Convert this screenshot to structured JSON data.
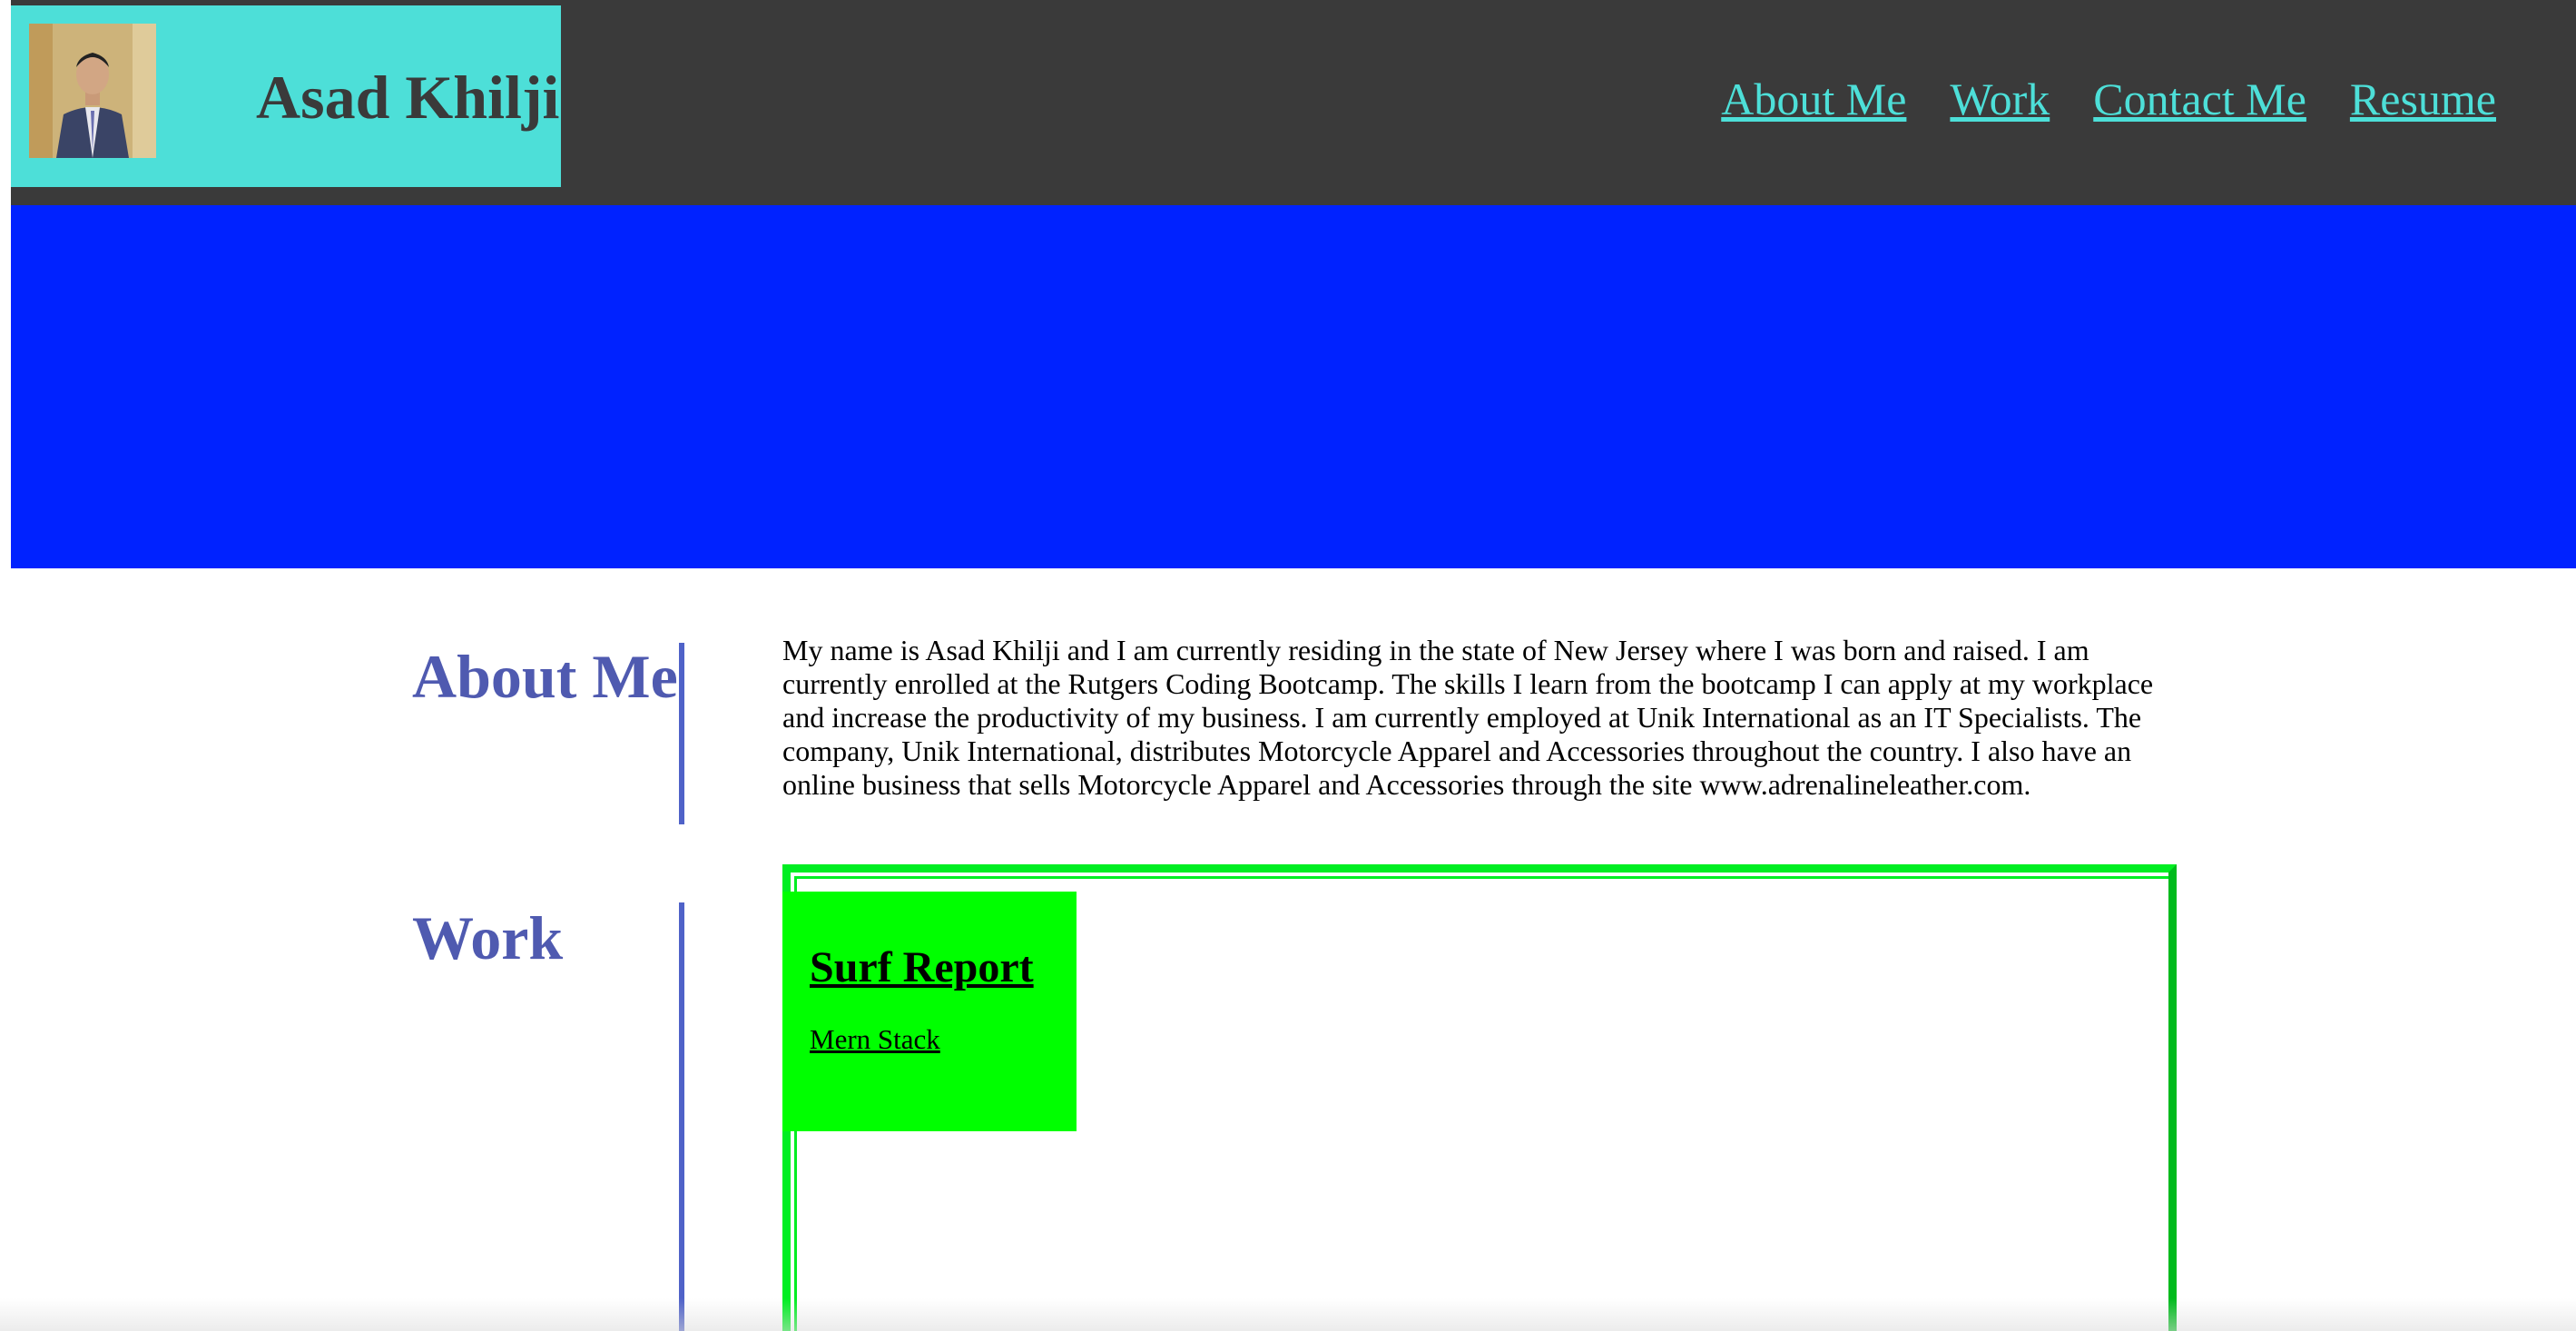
{
  "header": {
    "avatar_alt": "Asad Khilji photo",
    "brand_name": "Asad Khilji",
    "nav": [
      {
        "label": "About Me"
      },
      {
        "label": "Work"
      },
      {
        "label": "Contact Me"
      },
      {
        "label": "Resume"
      }
    ]
  },
  "about": {
    "title": "About Me",
    "text": "My name is Asad Khilji and I am currently residing in the state of New Jersey where I was born and raised. I am currently enrolled at the Rutgers Coding Bootcamp. The skills I learn from the bootcamp I can apply at my workplace and increase the productivity of my business. I am currently employed at Unik International as an IT Specialists. The company, Unik International, distributes Motorcycle Apparel and Accessories throughout the country. I also have an online business that sells Motorcycle Apparel and Accessories through the site www.adrenalineleather.com."
  },
  "work": {
    "title": "Work",
    "projects": [
      {
        "title": "Surf Report",
        "stack": "Mern Stack"
      }
    ]
  },
  "colors": {
    "header_bg": "#3a3a3a",
    "brand_bg": "#4ddfd8",
    "nav_link": "#4ddfd8",
    "hero_bg": "#0022ff",
    "section_title": "#4f5ab0",
    "card_bg": "#00ff00",
    "frame_border": "#00ee22"
  }
}
